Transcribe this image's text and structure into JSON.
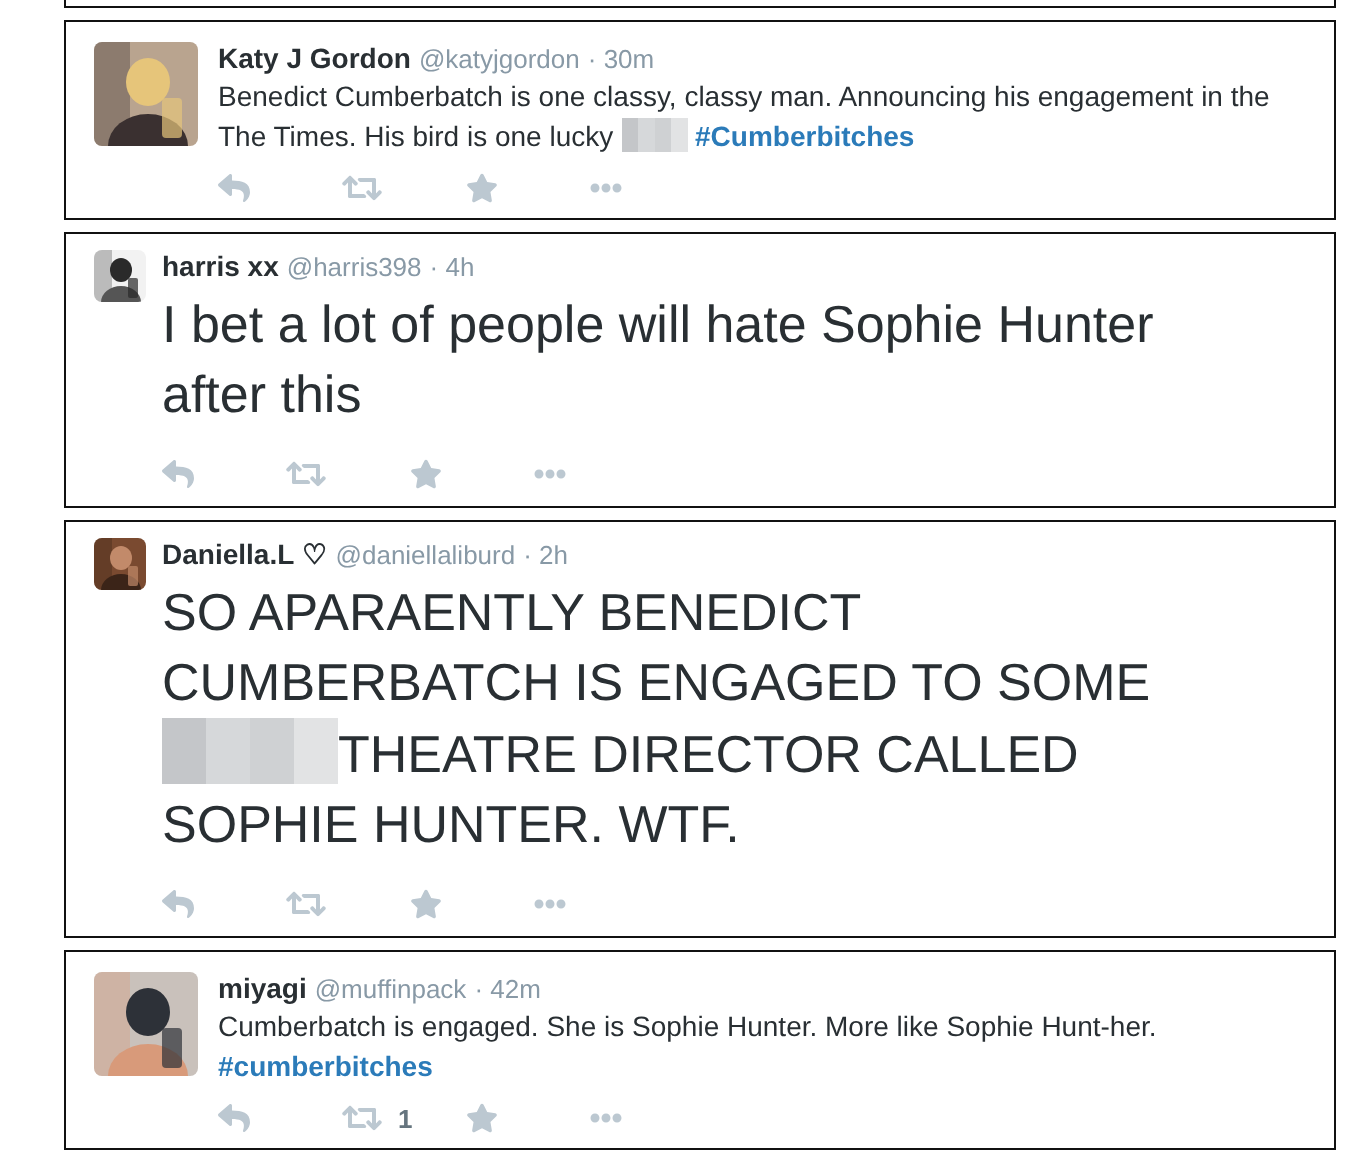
{
  "tweets": [
    {
      "name": "Katy J Gordon",
      "handle": "@katyjgordon",
      "time": "· 30m",
      "kind": "normal",
      "body": [
        {
          "kind": "text",
          "text": "Benedict Cumberbatch is one classy, classy man. Announcing his engagement in the The Times. His bird is one lucky "
        },
        {
          "kind": "redacted"
        },
        {
          "kind": "hashtag",
          "text": "#Cumberbitches"
        }
      ]
    },
    {
      "name": "harris xx",
      "handle": "@harris398",
      "time": "· 4h",
      "kind": "large",
      "body": [
        {
          "kind": "text",
          "text": "I bet a lot of people will hate Sophie Hunter after this"
        }
      ]
    },
    {
      "name": "Daniella.L ♡",
      "handle": "@daniellaliburd",
      "time": "· 2h",
      "kind": "large",
      "body": [
        {
          "kind": "text",
          "text": "SO APARAENTLY BENEDICT CUMBERBATCH IS ENGAGED TO SOME "
        },
        {
          "kind": "redacted"
        },
        {
          "kind": "text",
          "text": "THEATRE DIRECTOR CALLED SOPHIE HUNTER. WTF."
        }
      ]
    },
    {
      "name": "miyagi",
      "handle": "@muffinpack",
      "time": "· 42m",
      "kind": "normal",
      "retweet_count": "1",
      "body": [
        {
          "kind": "text",
          "text": "Cumberbatch is engaged. She is Sophie Hunter. More like Sophie Hunt-her. "
        },
        {
          "kind": "hashtag",
          "text": "#cumberbitches"
        }
      ]
    }
  ]
}
